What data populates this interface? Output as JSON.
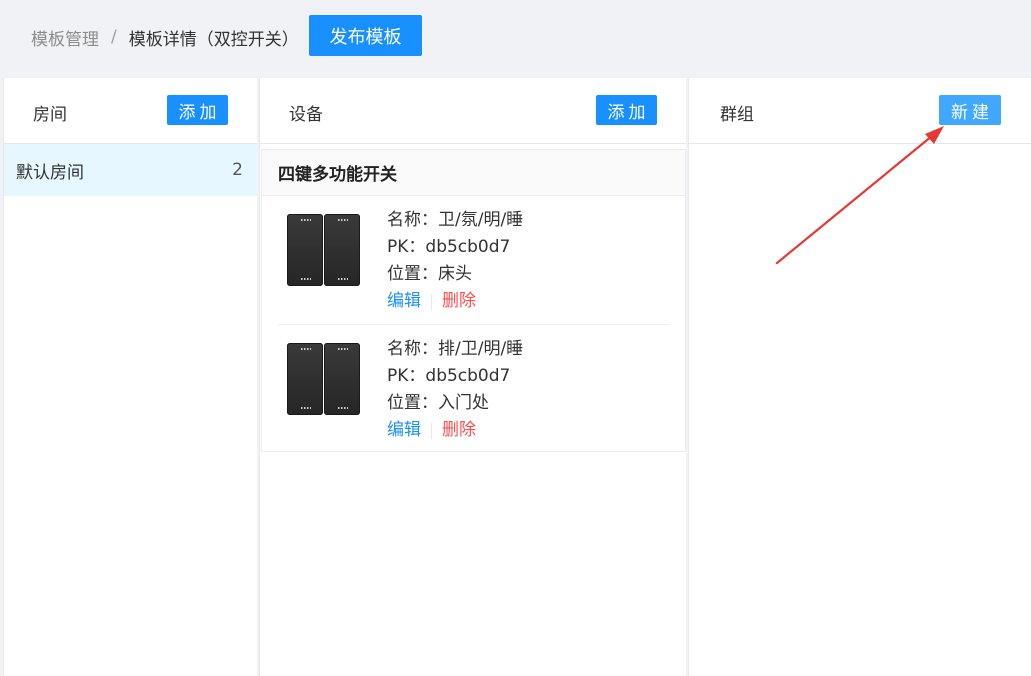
{
  "breadcrumb": {
    "parent": "模板管理",
    "separator": "/",
    "current": "模板详情（双控开关）"
  },
  "header": {
    "publish_label": "发布模板"
  },
  "rooms": {
    "title": "房间",
    "add_label": "添加",
    "items": [
      {
        "name": "默认房间",
        "count": "2"
      }
    ]
  },
  "devices": {
    "title": "设备",
    "add_label": "添加",
    "card_title": "四键多功能开关",
    "items": [
      {
        "name": "名称：卫/氛/明/睡",
        "pk": "PK：db5cb0d7",
        "location": "位置：床头",
        "edit": "编辑",
        "delete": "删除"
      },
      {
        "name": "名称：排/卫/明/睡",
        "pk": "PK：db5cb0d7",
        "location": "位置：入门处",
        "edit": "编辑",
        "delete": "删除"
      }
    ]
  },
  "groups": {
    "title": "群组",
    "new_label": "新建"
  },
  "colors": {
    "primary": "#1890ff",
    "danger": "#ff4d4f",
    "annotation_arrow": "#e53935"
  }
}
